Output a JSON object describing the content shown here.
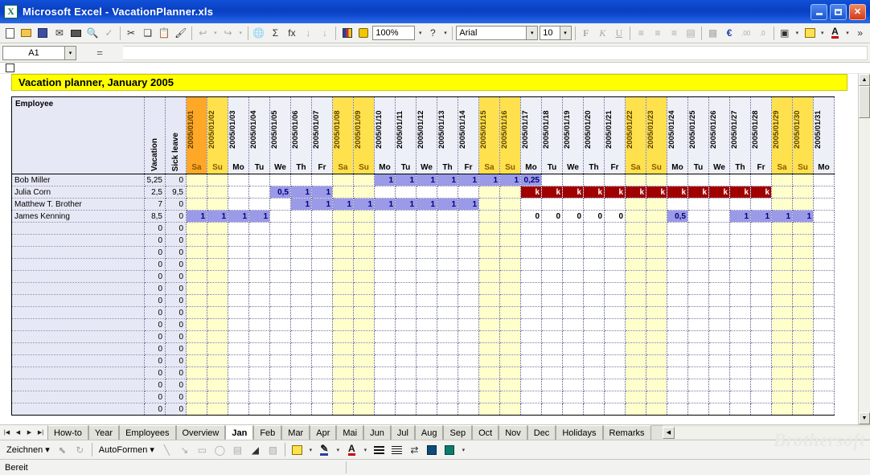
{
  "window": {
    "title": "Microsoft Excel - VacationPlanner.xls",
    "logo_glyph": "X",
    "minimize_label": "",
    "maximize_label": "",
    "close_label": "✕"
  },
  "toolbar": {
    "zoom_value": "100%",
    "font_value": "Arial",
    "font_size_value": "10",
    "bold_label": "F",
    "italic_label": "K",
    "underline_label": "U",
    "currency_label": "€",
    "sum_label": "Σ",
    "fx_label": "fx",
    "help_label": "?",
    "more_label": "»",
    "icons": [
      "new-document-icon",
      "open-folder-icon",
      "save-icon",
      "email-icon",
      "print-icon",
      "print-preview-icon",
      "spellcheck-icon",
      "cut-icon",
      "copy-icon",
      "paste-icon",
      "format-painter-icon",
      "undo-icon",
      "redo-icon",
      "hyperlink-icon",
      "autosum-icon",
      "function-icon",
      "sort-asc-icon",
      "sort-desc-icon",
      "chart-wizard-icon",
      "drawing-icon"
    ]
  },
  "formula_bar": {
    "name_box_value": "A1",
    "equals_label": "=",
    "formula_value": ""
  },
  "sheet": {
    "banner_title": "Vacation planner, January 2005",
    "columns": {
      "employee": "Employee",
      "vacation": "Vacation",
      "sick_leave": "Sick leave"
    },
    "dates": [
      {
        "date": "2005/01/01",
        "dow": "Sa",
        "type": "hol"
      },
      {
        "date": "2005/01/02",
        "dow": "Su",
        "type": "we"
      },
      {
        "date": "2005/01/03",
        "dow": "Mo",
        "type": "wd"
      },
      {
        "date": "2005/01/04",
        "dow": "Tu",
        "type": "wd"
      },
      {
        "date": "2005/01/05",
        "dow": "We",
        "type": "wd"
      },
      {
        "date": "2005/01/06",
        "dow": "Th",
        "type": "wd"
      },
      {
        "date": "2005/01/07",
        "dow": "Fr",
        "type": "wd"
      },
      {
        "date": "2005/01/08",
        "dow": "Sa",
        "type": "we"
      },
      {
        "date": "2005/01/09",
        "dow": "Su",
        "type": "we"
      },
      {
        "date": "2005/01/10",
        "dow": "Mo",
        "type": "wd"
      },
      {
        "date": "2005/01/11",
        "dow": "Tu",
        "type": "wd"
      },
      {
        "date": "2005/01/12",
        "dow": "We",
        "type": "wd"
      },
      {
        "date": "2005/01/13",
        "dow": "Th",
        "type": "wd"
      },
      {
        "date": "2005/01/14",
        "dow": "Fr",
        "type": "wd"
      },
      {
        "date": "2005/01/15",
        "dow": "Sa",
        "type": "we"
      },
      {
        "date": "2005/01/16",
        "dow": "Su",
        "type": "we"
      },
      {
        "date": "2005/01/17",
        "dow": "Mo",
        "type": "wd"
      },
      {
        "date": "2005/01/18",
        "dow": "Tu",
        "type": "wd"
      },
      {
        "date": "2005/01/19",
        "dow": "We",
        "type": "wd"
      },
      {
        "date": "2005/01/20",
        "dow": "Th",
        "type": "wd"
      },
      {
        "date": "2005/01/21",
        "dow": "Fr",
        "type": "wd"
      },
      {
        "date": "2005/01/22",
        "dow": "Sa",
        "type": "we"
      },
      {
        "date": "2005/01/23",
        "dow": "Su",
        "type": "we"
      },
      {
        "date": "2005/01/24",
        "dow": "Mo",
        "type": "wd"
      },
      {
        "date": "2005/01/25",
        "dow": "Tu",
        "type": "wd"
      },
      {
        "date": "2005/01/26",
        "dow": "We",
        "type": "wd"
      },
      {
        "date": "2005/01/27",
        "dow": "Th",
        "type": "wd"
      },
      {
        "date": "2005/01/28",
        "dow": "Fr",
        "type": "wd"
      },
      {
        "date": "2005/01/29",
        "dow": "Sa",
        "type": "we"
      },
      {
        "date": "2005/01/30",
        "dow": "Su",
        "type": "we"
      },
      {
        "date": "2005/01/31",
        "dow": "Mo",
        "type": "wd"
      }
    ],
    "rows": [
      {
        "name": "Bob Miller",
        "vacation": "5,25",
        "sick": "0",
        "cells": {
          "9": {
            "v": "1",
            "k": "vac"
          },
          "10": {
            "v": "1",
            "k": "vac"
          },
          "11": {
            "v": "1",
            "k": "vac"
          },
          "12": {
            "v": "1",
            "k": "vac"
          },
          "13": {
            "v": "1",
            "k": "vac"
          },
          "14": {
            "v": "1",
            "k": "vac"
          },
          "15": {
            "v": "1",
            "k": "vac"
          },
          "16": {
            "v": "0,25",
            "k": "vac"
          }
        }
      },
      {
        "name": "Julia Corn",
        "vacation": "2,5",
        "sick": "9,5",
        "cells": {
          "4": {
            "v": "0,5",
            "k": "vac"
          },
          "5": {
            "v": "1",
            "k": "vac"
          },
          "6": {
            "v": "1",
            "k": "vac"
          },
          "16": {
            "v": "k",
            "k": "sick"
          },
          "17": {
            "v": "k",
            "k": "sick"
          },
          "18": {
            "v": "k",
            "k": "sick"
          },
          "19": {
            "v": "k",
            "k": "sick"
          },
          "20": {
            "v": "k",
            "k": "sick"
          },
          "21": {
            "v": "k",
            "k": "sick"
          },
          "22": {
            "v": "k",
            "k": "sick"
          },
          "23": {
            "v": "k",
            "k": "sick"
          },
          "24": {
            "v": "k",
            "k": "sick"
          },
          "25": {
            "v": "k",
            "k": "sick"
          },
          "26": {
            "v": "k",
            "k": "sick"
          },
          "27": {
            "v": "k",
            "k": "sick"
          }
        }
      },
      {
        "name": "Matthew T. Brother",
        "vacation": "7",
        "sick": "0",
        "cells": {
          "5": {
            "v": "1",
            "k": "vac"
          },
          "6": {
            "v": "1",
            "k": "vac"
          },
          "7": {
            "v": "1",
            "k": "vac"
          },
          "8": {
            "v": "1",
            "k": "vac"
          },
          "9": {
            "v": "1",
            "k": "vac"
          },
          "10": {
            "v": "1",
            "k": "vac"
          },
          "11": {
            "v": "1",
            "k": "vac"
          },
          "12": {
            "v": "1",
            "k": "vac"
          },
          "13": {
            "v": "1",
            "k": "vac"
          }
        }
      },
      {
        "name": "James Kenning",
        "vacation": "8,5",
        "sick": "0",
        "cells": {
          "0": {
            "v": "1",
            "k": "vac"
          },
          "1": {
            "v": "1",
            "k": "vac"
          },
          "2": {
            "v": "1",
            "k": "vac"
          },
          "3": {
            "v": "1",
            "k": "vac"
          },
          "16": {
            "v": "0",
            "k": "zero"
          },
          "17": {
            "v": "0",
            "k": "zero"
          },
          "18": {
            "v": "0",
            "k": "zero"
          },
          "19": {
            "v": "0",
            "k": "zero"
          },
          "20": {
            "v": "0",
            "k": "zero"
          },
          "23": {
            "v": "0,5",
            "k": "vac"
          },
          "26": {
            "v": "1",
            "k": "vac"
          },
          "27": {
            "v": "1",
            "k": "vac"
          },
          "28": {
            "v": "1",
            "k": "vac"
          },
          "29": {
            "v": "1",
            "k": "vac"
          }
        }
      },
      {
        "name": "",
        "vacation": "0",
        "sick": "0",
        "cells": {}
      },
      {
        "name": "",
        "vacation": "0",
        "sick": "0",
        "cells": {}
      },
      {
        "name": "",
        "vacation": "0",
        "sick": "0",
        "cells": {}
      },
      {
        "name": "",
        "vacation": "0",
        "sick": "0",
        "cells": {}
      },
      {
        "name": "",
        "vacation": "0",
        "sick": "0",
        "cells": {}
      },
      {
        "name": "",
        "vacation": "0",
        "sick": "0",
        "cells": {}
      },
      {
        "name": "",
        "vacation": "0",
        "sick": "0",
        "cells": {}
      },
      {
        "name": "",
        "vacation": "0",
        "sick": "0",
        "cells": {}
      },
      {
        "name": "",
        "vacation": "0",
        "sick": "0",
        "cells": {}
      },
      {
        "name": "",
        "vacation": "0",
        "sick": "0",
        "cells": {}
      },
      {
        "name": "",
        "vacation": "0",
        "sick": "0",
        "cells": {}
      },
      {
        "name": "",
        "vacation": "0",
        "sick": "0",
        "cells": {}
      },
      {
        "name": "",
        "vacation": "0",
        "sick": "0",
        "cells": {}
      },
      {
        "name": "",
        "vacation": "0",
        "sick": "0",
        "cells": {}
      },
      {
        "name": "",
        "vacation": "0",
        "sick": "0",
        "cells": {}
      },
      {
        "name": "",
        "vacation": "0",
        "sick": "0",
        "cells": {}
      }
    ],
    "colors": {
      "banner_bg": "#ffff00",
      "holiday_bg": "#ffa726",
      "weekend_bg": "#ffe14d",
      "weekend_cell_bg": "#ffffcc",
      "vacation_bg": "#9a9ae8",
      "sick_bg": "#a00000",
      "header_bg": "#e6e9f5"
    }
  },
  "tabs": {
    "items": [
      {
        "label": "How-to",
        "active": false
      },
      {
        "label": "Year",
        "active": false
      },
      {
        "label": "Employees",
        "active": false
      },
      {
        "label": "Overview",
        "active": false
      },
      {
        "label": "Jan",
        "active": true
      },
      {
        "label": "Feb",
        "active": false
      },
      {
        "label": "Mar",
        "active": false
      },
      {
        "label": "Apr",
        "active": false
      },
      {
        "label": "Mai",
        "active": false
      },
      {
        "label": "Jun",
        "active": false
      },
      {
        "label": "Jul",
        "active": false
      },
      {
        "label": "Aug",
        "active": false
      },
      {
        "label": "Sep",
        "active": false
      },
      {
        "label": "Oct",
        "active": false
      },
      {
        "label": "Nov",
        "active": false
      },
      {
        "label": "Dec",
        "active": false
      },
      {
        "label": "Holidays",
        "active": false
      },
      {
        "label": "Remarks",
        "active": false
      }
    ],
    "nav_first": "|◀",
    "nav_prev": "◀",
    "nav_next": "▶",
    "nav_last": "▶|"
  },
  "drawbar": {
    "draw_label": "Zeichnen",
    "autoshapes_label": "AutoFormen",
    "dropdown_glyph": "▾",
    "icons": [
      "select-objects-icon",
      "rotate-icon",
      "line-icon",
      "arrow-icon",
      "rectangle-icon",
      "oval-icon",
      "textbox-icon",
      "wordart-icon",
      "insert-picture-icon",
      "fill-color-icon",
      "line-color-icon",
      "font-color-icon",
      "line-style-icon",
      "dash-style-icon",
      "arrow-style-icon",
      "shadow-icon",
      "3d-icon"
    ]
  },
  "status": {
    "text": "Bereit"
  },
  "watermark": {
    "text": "Brothersoft"
  }
}
